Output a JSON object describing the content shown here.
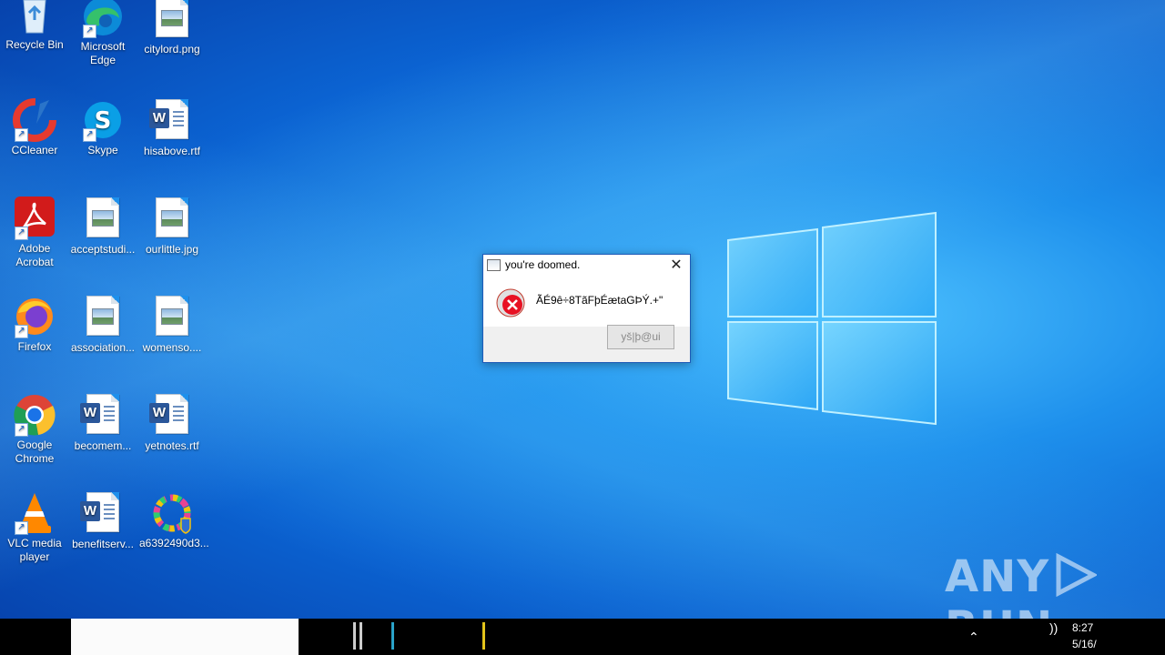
{
  "desktop": {
    "icons": [
      {
        "label": "Recycle Bin",
        "icon": "recycle-bin-icon"
      },
      {
        "label": "Microsoft Edge",
        "icon": "edge-icon"
      },
      {
        "label": "citylord.png",
        "icon": "image-file-icon"
      },
      {
        "label": "CCleaner",
        "icon": "ccleaner-icon"
      },
      {
        "label": "Skype",
        "icon": "skype-icon"
      },
      {
        "label": "hisabove.rtf",
        "icon": "word-document-icon"
      },
      {
        "label": "Adobe Acrobat",
        "icon": "acrobat-icon"
      },
      {
        "label": "acceptstudi...",
        "icon": "image-file-icon"
      },
      {
        "label": "ourlittle.jpg",
        "icon": "image-file-icon"
      },
      {
        "label": "Firefox",
        "icon": "firefox-icon"
      },
      {
        "label": "association...",
        "icon": "image-file-icon"
      },
      {
        "label": "womenso....",
        "icon": "image-file-icon"
      },
      {
        "label": "Google Chrome",
        "icon": "chrome-icon"
      },
      {
        "label": "becomem...",
        "icon": "word-document-icon"
      },
      {
        "label": "yetnotes.rtf",
        "icon": "word-document-icon"
      },
      {
        "label": "VLC media player",
        "icon": "vlc-icon"
      },
      {
        "label": "benefitserv...",
        "icon": "word-document-icon"
      },
      {
        "label": "a6392490d3...",
        "icon": "colorful-ring-icon"
      }
    ]
  },
  "dialog": {
    "title": "you're doomed.",
    "message": "ÃÉ9ê÷8TãFþÉætaGÞÝ.+\"",
    "button_label": "yš|þ@ui",
    "icon": "error-icon"
  },
  "taskbar": {
    "time": "8:27",
    "date": "5/16/"
  },
  "watermark": {
    "left": "ANY",
    "right": "RUN"
  },
  "colors": {
    "accent": "#1e5bb8",
    "error_red": "#e81123"
  }
}
